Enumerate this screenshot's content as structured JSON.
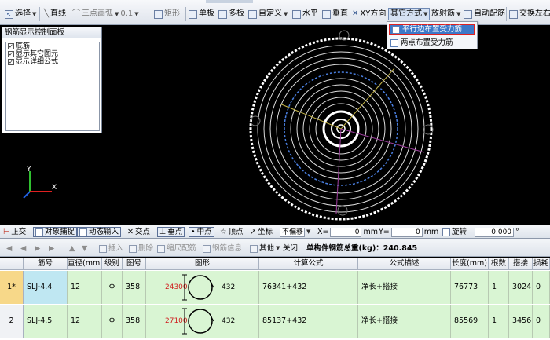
{
  "toolbar": {
    "select_label": "选择",
    "line_label": "直线",
    "arc3_label": "三点画弧",
    "arc_value": "0.1",
    "rect_label": "矩形",
    "single_board": "单板",
    "multi_board": "多板",
    "custom": "自定义",
    "horizontal": "水平",
    "vertical": "垂直",
    "xy_dir": "XY方向",
    "other_method": "其它方式",
    "radial": "放射筋",
    "auto_place": "自动配筋",
    "swap": "交换左右"
  },
  "other_menu": {
    "items": [
      "平行边布置受力筋",
      "两点布置受力筋"
    ]
  },
  "panel": {
    "title": "钢筋显示控制面板",
    "items": [
      "底筋",
      "显示其它图元",
      "显示详细公式"
    ]
  },
  "snapbar": {
    "ortho": "正交",
    "obj_snap": "对象捕捉",
    "dyn_input": "动态输入",
    "intersection": "交点",
    "perpendicular": "垂点",
    "midpoint": "中点",
    "vertex": "顶点",
    "coord": "坐标",
    "offset_mode": "不偏移",
    "x_label": "X=",
    "x_value": "0",
    "mm1": "mm",
    "y_label": "Y=",
    "y_value": "0",
    "mm2": "mm",
    "rotate_label": "旋转",
    "rotate_value": "0.000",
    "degree": "°"
  },
  "gridbar": {
    "insert": "插入",
    "delete": "删除",
    "scale": "缩尺配筋",
    "rebar_info": "钢筋信息",
    "other": "其他",
    "close": "关闭",
    "total_label": "单构件钢筋总重(kg)：240.845"
  },
  "table": {
    "headers": [
      "筋号",
      "直径(mm)",
      "级别",
      "图号",
      "图形",
      "计算公式",
      "公式描述",
      "长度(mm)",
      "根数",
      "搭接",
      "损耗"
    ],
    "rows": [
      {
        "num": "1*",
        "name": "SLJ-4.4",
        "dia": "12",
        "grade": "Φ",
        "fig": "358",
        "shape_len": "24300",
        "shape_val": "432",
        "formula": "76341+432",
        "desc": "净长+搭接",
        "length": "76773",
        "count": "1",
        "lap": "3024",
        "loss": "0"
      },
      {
        "num": "2",
        "name": "SLJ-4.5",
        "dia": "12",
        "grade": "Φ",
        "fig": "358",
        "shape_len": "27100",
        "shape_val": "432",
        "formula": "85137+432",
        "desc": "净长+搭接",
        "length": "85569",
        "count": "1",
        "lap": "3456",
        "loss": "0"
      }
    ]
  }
}
